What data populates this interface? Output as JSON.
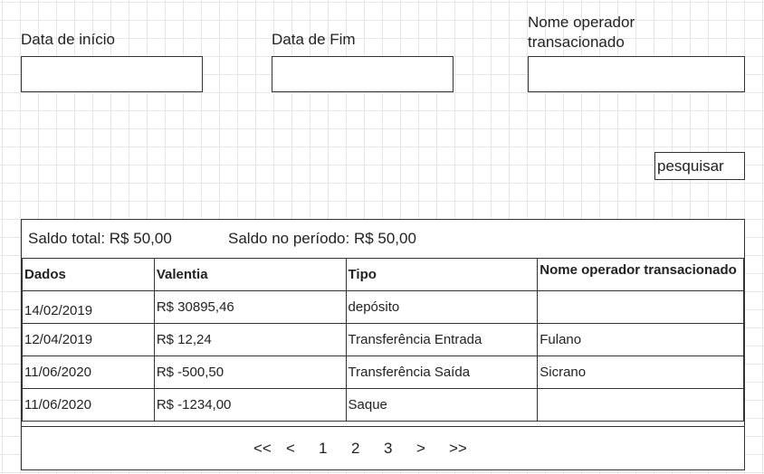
{
  "filters": {
    "start_date_label": "Data de início",
    "end_date_label": "Data de Fim",
    "operator_label": "Nome operador transacionado",
    "start_date_value": "",
    "end_date_value": "",
    "operator_value": ""
  },
  "search_button_label": "pesquisar",
  "summary": {
    "total": "Saldo total: R$ 50,00",
    "period": "Saldo no período: R$ 50,00"
  },
  "table": {
    "headers": [
      "Dados",
      "Valentia",
      "Tipo",
      "Nome operador transacionado"
    ],
    "rows": [
      [
        "14/02/2019",
        "R$ 30895,46",
        "depósito",
        ""
      ],
      [
        "12/04/2019",
        "R$ 12,24",
        "Transferência Entrada",
        "Fulano"
      ],
      [
        "11/06/2020",
        "R$ -500,50",
        "Transferência Saída",
        "Sicrano"
      ],
      [
        "11/06/2020",
        "R$ -1234,00",
        "Saque",
        ""
      ]
    ]
  },
  "pagination": {
    "first": "<<",
    "prev": "<",
    "pages": [
      "1",
      "2",
      "3"
    ],
    "next": ">",
    "last": ">>"
  }
}
